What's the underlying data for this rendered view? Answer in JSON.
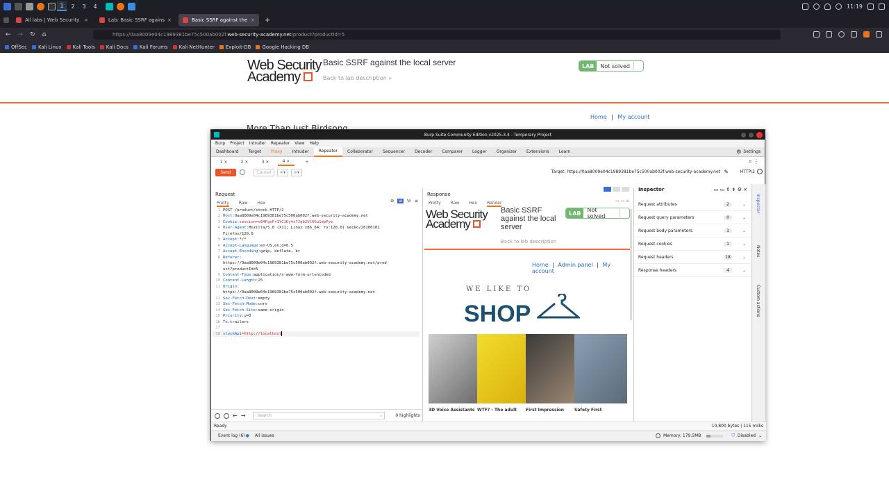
{
  "kali": {
    "workspaces": [
      "1",
      "2",
      "3",
      "4"
    ],
    "clock": "11:19"
  },
  "tabs": [
    {
      "title": "All labs | Web Security Ac"
    },
    {
      "title": "Lab: Basic SSRF against t"
    },
    {
      "title": "Basic SSRF against the lo"
    }
  ],
  "url": {
    "prefix": "https://0aa8009e04c1989381be75c500ab002f.",
    "domain": "web-security-academy.net",
    "path": "/product?productId=5"
  },
  "bookmarks": [
    "OffSec",
    "Kali Linux",
    "Kali Tools",
    "Kali Docs",
    "Kali Forums",
    "Kali NetHunter",
    "Exploit-DB",
    "Google Hacking DB"
  ],
  "page": {
    "logo_line1": "Web Security",
    "logo_line2": "Academy",
    "title": "Basic SSRF against the local server",
    "back": "Back to lab description",
    "lab": "LAB",
    "status": "Not solved",
    "nav_home": "Home",
    "nav_sep": "|",
    "nav_account": "My account",
    "heading": "More Than Just Birdsong"
  },
  "burp": {
    "title": "Burp Suite Community Edition v2025.3.4 - Temporary Project",
    "menu": [
      "Burp",
      "Project",
      "Intruder",
      "Repeater",
      "View",
      "Help"
    ],
    "tabs": [
      "Dashboard",
      "Target",
      "Proxy",
      "Intruder",
      "Repeater",
      "Collaborator",
      "Sequencer",
      "Decoder",
      "Comparer",
      "Logger",
      "Organizer",
      "Extensions",
      "Learn"
    ],
    "settings": "Settings",
    "subtabs": [
      "1 ×",
      "2 ×",
      "3 ×",
      "4 ×",
      "+"
    ],
    "send": "Send",
    "cancel": "Cancel",
    "target": "Target: https://0aa8009e04c1989381be75c500ab002f.web-security-academy.net",
    "http": "HTTP/2",
    "request_label": "Request",
    "response_label": "Response",
    "req_views": [
      "Pretty",
      "Raw",
      "Hex"
    ],
    "resp_views": [
      "Pretty",
      "Raw",
      "Hex",
      "Render"
    ],
    "request_lines": [
      {
        "n": "1",
        "k": "",
        "v": "POST /product/stock HTTP/2"
      },
      {
        "n": "2",
        "k": "Host:",
        "v": " 0aa8009e04c1989381be75c500ab002f.web-security-academy.net"
      },
      {
        "n": "3",
        "k": "Cookie:",
        "v": " session=v84FgnFr1YC1Uy4x7Jqb2VlO6u1dpPye"
      },
      {
        "n": "4",
        "k": "User-Agent:",
        "v": " Mozilla/5.0 (X11; Linux x86_64; rv:128.0) Gecko/20100101"
      },
      {
        "n": "",
        "k": "",
        "v": "Firefox/128.0"
      },
      {
        "n": "5",
        "k": "Accept:",
        "v": " */*"
      },
      {
        "n": "6",
        "k": "Accept-Language:",
        "v": " en-US,en;q=0.5"
      },
      {
        "n": "7",
        "k": "Accept-Encoding:",
        "v": " gzip, deflate, br"
      },
      {
        "n": "8",
        "k": "Referer:",
        "v": ""
      },
      {
        "n": "",
        "k": "",
        "v": "https://0aa8009e04c1989381be75c500ab002f.web-security-academy.net/prod"
      },
      {
        "n": "",
        "k": "",
        "v": "uct?productId=5"
      },
      {
        "n": "9",
        "k": "Content-Type:",
        "v": " application/x-www-form-urlencoded"
      },
      {
        "n": "10",
        "k": "Content-Length:",
        "v": " 25"
      },
      {
        "n": "11",
        "k": "Origin:",
        "v": ""
      },
      {
        "n": "",
        "k": "",
        "v": "https://0aa8009e04c1989381be75c500ab002f.web-security-academy.net"
      },
      {
        "n": "12",
        "k": "Sec-Fetch-Dest:",
        "v": " empty"
      },
      {
        "n": "13",
        "k": "Sec-Fetch-Mode:",
        "v": " cors"
      },
      {
        "n": "14",
        "k": "Sec-Fetch-Site:",
        "v": " same-origin"
      },
      {
        "n": "15",
        "k": "Priority:",
        "v": " u=0"
      },
      {
        "n": "16",
        "k": "Te:",
        "v": " trailers"
      },
      {
        "n": "17",
        "k": "",
        "v": ""
      },
      {
        "n": "18",
        "k": "stockApi",
        "v": "=http://localhost"
      }
    ],
    "search_placeholder": "Search",
    "highlights": "0 highlights",
    "render": {
      "logo_line1": "Web Security",
      "logo_line2": "Academy",
      "title": "Basic SSRF against the local server",
      "lab": "LAB",
      "status": "Not solved",
      "back": "Back to lab description",
      "nav": [
        "Home",
        "Admin panel",
        "My account"
      ],
      "welike": "WE LIKE TO",
      "shop": "SHOP",
      "products": [
        "3D Voice Assistants",
        "WTF? - The adult",
        "First Impression",
        "Safety First"
      ]
    },
    "inspector": {
      "title": "Inspector",
      "rows": [
        {
          "label": "Request attributes",
          "count": "2"
        },
        {
          "label": "Request query parameters",
          "count": "0"
        },
        {
          "label": "Request body parameters",
          "count": "1"
        },
        {
          "label": "Request cookies",
          "count": "1"
        },
        {
          "label": "Request headers",
          "count": "18"
        },
        {
          "label": "Response headers",
          "count": "4"
        }
      ]
    },
    "side": [
      "Inspector",
      "Notes",
      "Custom actions"
    ],
    "status_left": "Ready",
    "status_right": "10,800 bytes | 115 millis",
    "event_log": "Event log (6)",
    "all_issues": "All issues",
    "memory": "Memory: 179.5MB",
    "disabled": "Disabled"
  }
}
